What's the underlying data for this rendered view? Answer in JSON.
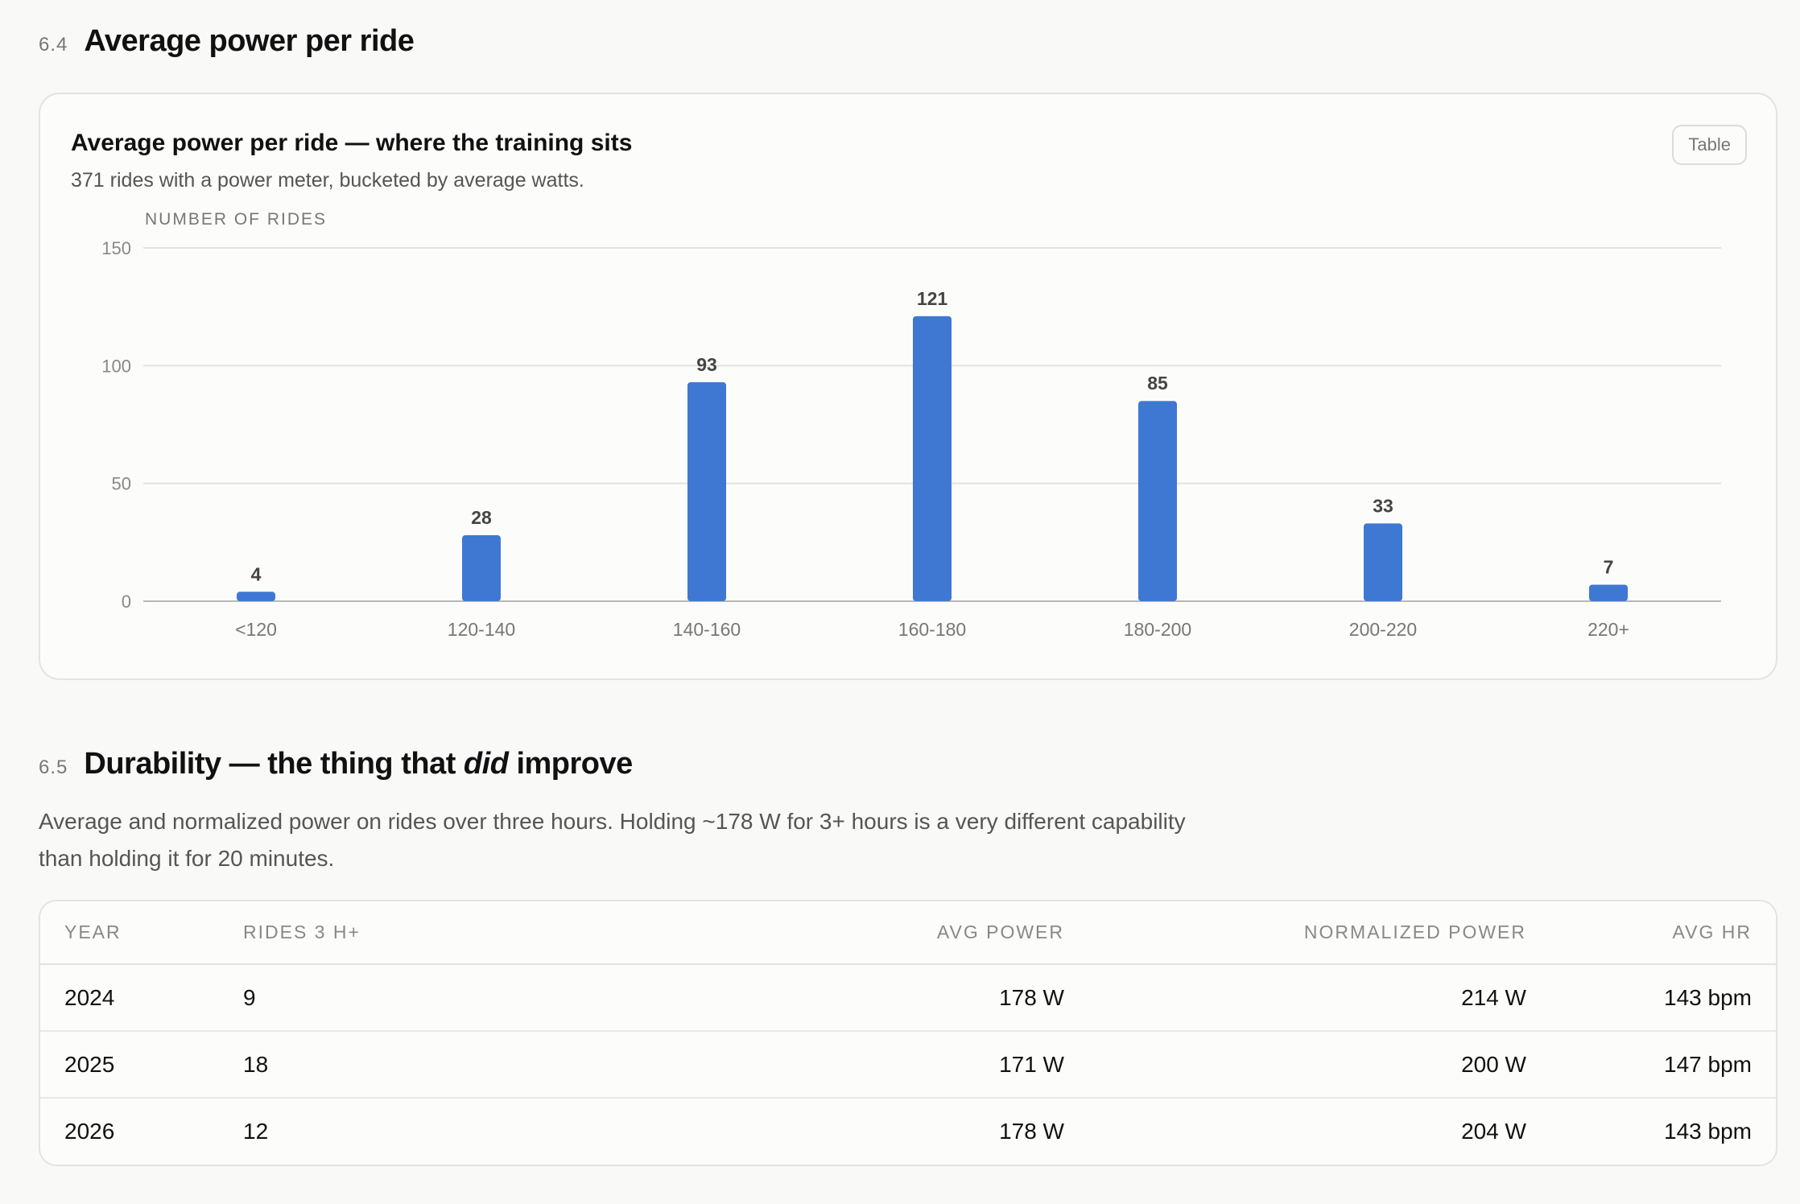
{
  "section1": {
    "number": "6.4",
    "title": "Average power per ride"
  },
  "card": {
    "title": "Average power per ride — where the training sits",
    "subtitle": "371 rides with a power meter, bucketed by average watts.",
    "table_button": "Table"
  },
  "chart_data": {
    "type": "bar",
    "title": "Average power per ride — where the training sits",
    "ylabel": "NUMBER OF RIDES",
    "xlabel": "",
    "categories": [
      "<120",
      "120-140",
      "140-160",
      "160-180",
      "180-200",
      "200-220",
      "220+"
    ],
    "values": [
      4,
      28,
      93,
      121,
      85,
      33,
      7
    ],
    "ylim": [
      0,
      150
    ],
    "yticks": [
      0,
      50,
      100,
      150
    ],
    "grid": true,
    "bar_color": "#3f78d3"
  },
  "section2": {
    "number": "6.5",
    "title_pre": "Durability — the thing that ",
    "title_em": "did",
    "title_post": " improve",
    "description": "Average and normalized power on rides over three hours. Holding ~178 W for 3+ hours is a very different capability than holding it for 20 minutes."
  },
  "table": {
    "headers": [
      "Year",
      "Rides 3 h+",
      "Avg power",
      "Normalized power",
      "Avg HR"
    ],
    "rows": [
      [
        "2024",
        "9",
        "178 W",
        "214 W",
        "143 bpm"
      ],
      [
        "2025",
        "18",
        "171 W",
        "200 W",
        "147 bpm"
      ],
      [
        "2026",
        "12",
        "178 W",
        "204 W",
        "143 bpm"
      ]
    ]
  }
}
